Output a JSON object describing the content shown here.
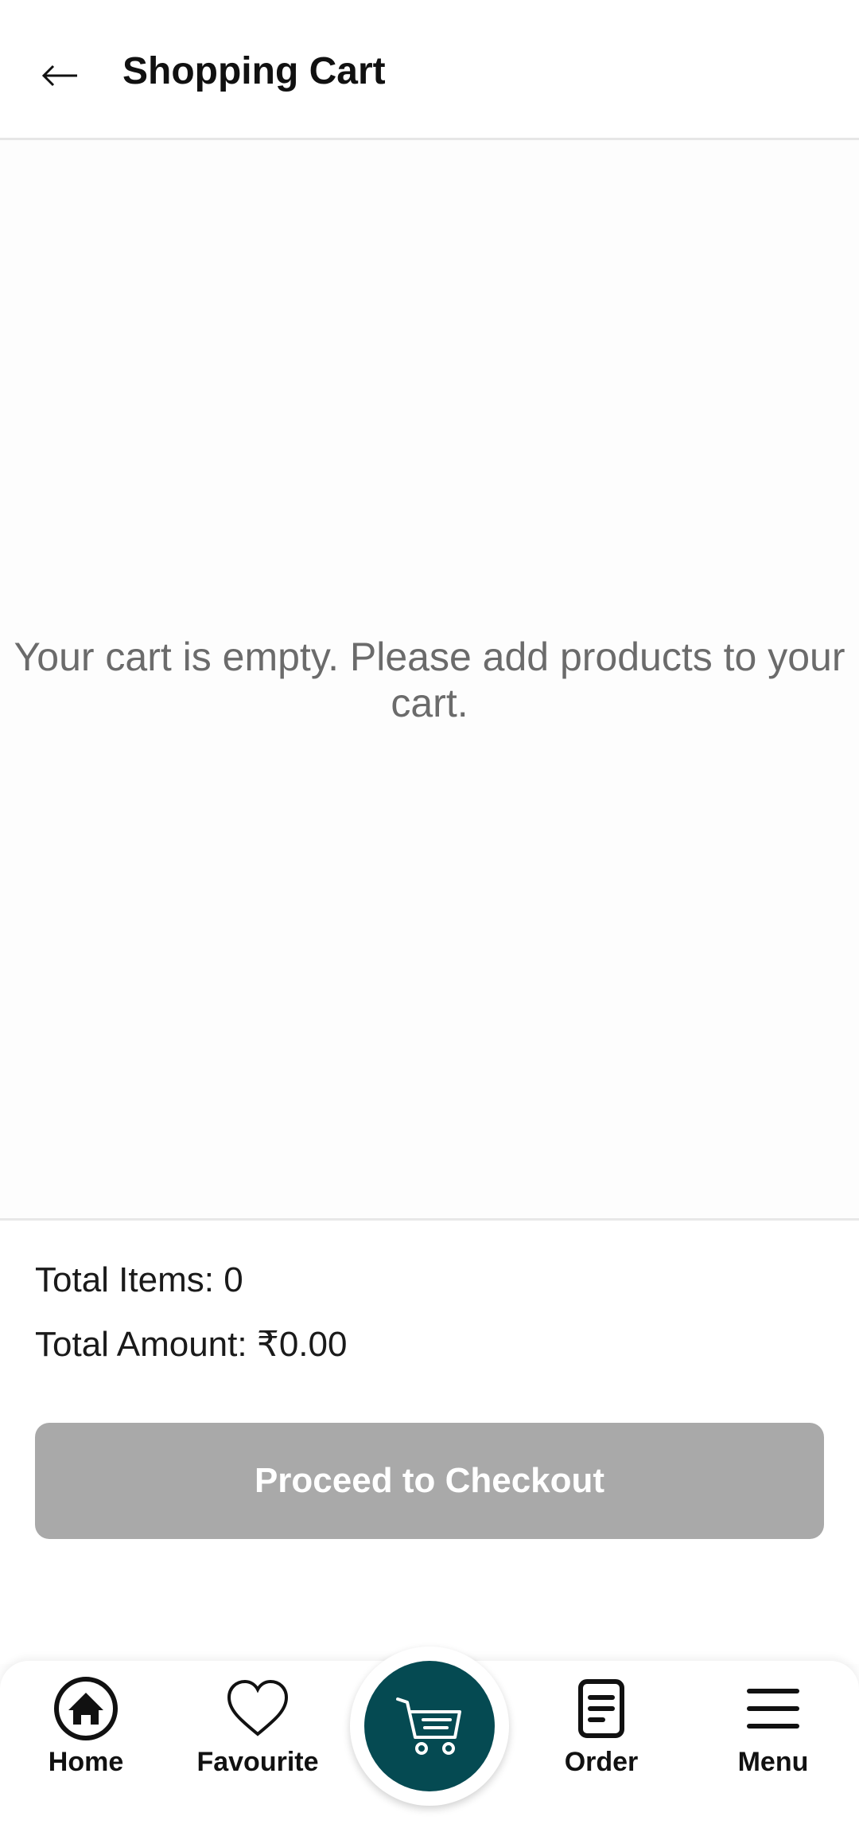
{
  "header": {
    "title": "Shopping Cart"
  },
  "cart": {
    "empty_message": "Your cart is empty. Please add products to your cart."
  },
  "summary": {
    "total_items": "Total Items: 0",
    "total_amount": "Total Amount: ₹0.00",
    "checkout_label": "Proceed to Checkout"
  },
  "bottom_nav": {
    "items": [
      {
        "label": "Home",
        "icon": "home-icon"
      },
      {
        "label": "Favourite",
        "icon": "heart-icon"
      },
      {
        "label": "",
        "icon": "cart-icon"
      },
      {
        "label": "Order",
        "icon": "order-icon"
      },
      {
        "label": "Menu",
        "icon": "menu-icon"
      }
    ]
  },
  "colors": {
    "accent": "#054a52",
    "button_disabled": "#a9a9a9",
    "muted_text": "#6b6b6b"
  }
}
